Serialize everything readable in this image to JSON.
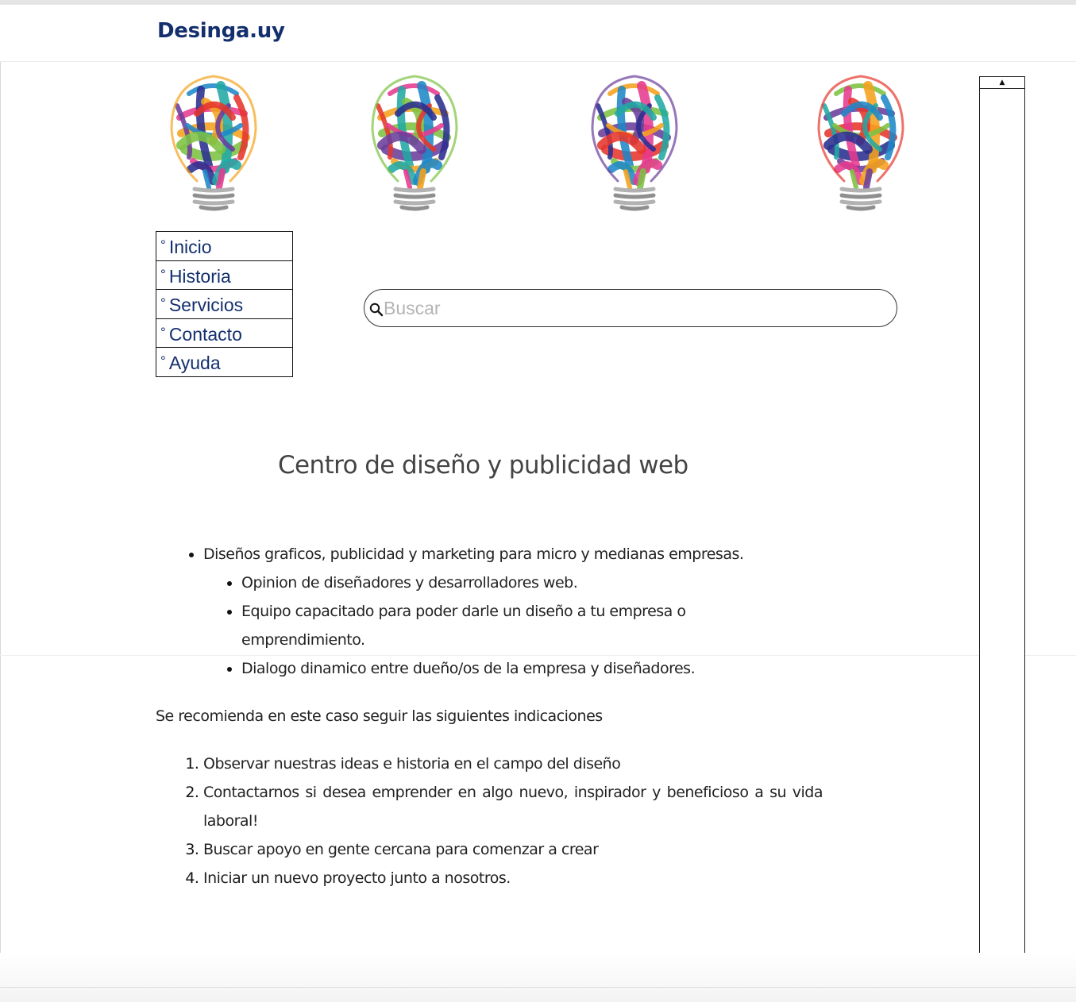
{
  "header": {
    "brand": "Desinga.uy"
  },
  "hero": {
    "images": [
      {
        "icon": "lightbulb-logo-icon"
      },
      {
        "icon": "lightbulb-logo-icon"
      },
      {
        "icon": "lightbulb-logo-icon"
      },
      {
        "icon": "lightbulb-logo-icon"
      }
    ]
  },
  "nav": {
    "bullet": "°",
    "items": [
      {
        "label": "Inicio"
      },
      {
        "label": "Historia"
      },
      {
        "label": "Servicios"
      },
      {
        "label": "Contacto"
      },
      {
        "label": "Ayuda"
      }
    ]
  },
  "search": {
    "placeholder": "Buscar",
    "value": ""
  },
  "main": {
    "title": "Centro de diseño y publicidad web",
    "bullets": {
      "main": "Diseños graficos, publicidad y marketing para micro y medianas empresas.",
      "sub": [
        "Opinion de diseñadores y desarrolladores web.",
        "Equipo capacitado para poder darle un diseño a tu empresa o emprendimiento.",
        "Dialogo dinamico entre dueño/os de la empresa y diseñadores."
      ]
    },
    "recommendation": "Se recomienda en este caso seguir las siguientes indicaciones",
    "steps": [
      "Observar nuestras ideas e historia en el campo del diseño",
      "Contactarnos si desea emprender en algo nuevo, inspirador y beneficioso a su vida laboral!",
      "Buscar apoyo en gente cercana para comenzar a crear",
      "Iniciar un nuevo proyecto junto a nosotros."
    ]
  },
  "sidebar": {
    "scroll_arrow": "▲"
  },
  "colors": {
    "brand": "#142f6e",
    "link": "#142f6e",
    "text": "#222222",
    "heading": "#444444",
    "bulb_palette": [
      "#1e88c7",
      "#e63a8e",
      "#f4a21c",
      "#7cc242",
      "#6a3d9a",
      "#e5362c",
      "#2a2f8f",
      "#21a9a3"
    ]
  }
}
